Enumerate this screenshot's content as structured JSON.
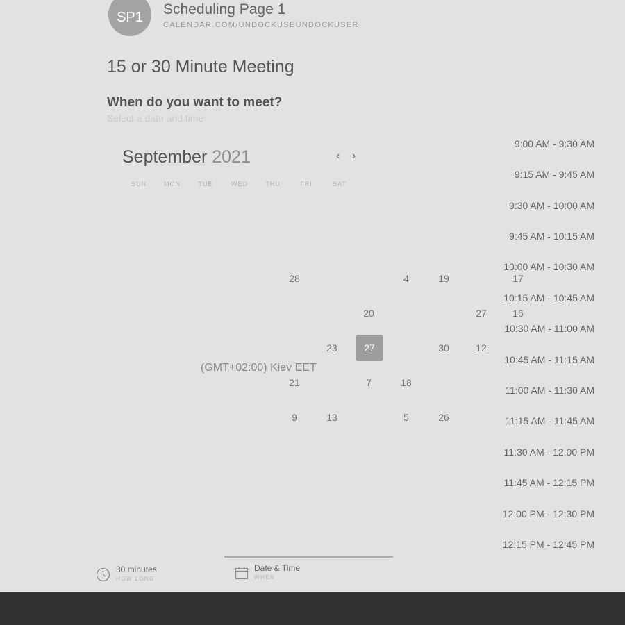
{
  "header": {
    "avatar_initials": "SP1",
    "page_name": "Scheduling Page 1",
    "page_url": "CALENDAR.COM/UNDOCKUSEUNDOCKUSER"
  },
  "meeting": {
    "title": "15 or 30 Minute Meeting",
    "question": "When do you want to meet?",
    "subtext": "Select a date and time"
  },
  "calendar": {
    "month": "September",
    "year": "2021",
    "prev_icon": "chevron-left-icon",
    "next_icon": "chevron-right-icon",
    "prev_glyph": "‹",
    "next_glyph": "›",
    "weekdays": [
      "SUN",
      "MON",
      "TUE",
      "WED",
      "THU",
      "FRI",
      "SAT"
    ],
    "visible_days": [
      "28",
      "4",
      "19",
      "17",
      "20",
      "27",
      "16",
      "23",
      "27",
      "30",
      "12",
      "21",
      "7",
      "18",
      "9",
      "13",
      "5",
      "26"
    ],
    "selected_day": "27",
    "timezone": "(GMT+02:00) Kiev EET"
  },
  "time_slots": [
    "9:00 AM - 9:30 AM",
    "9:15 AM - 9:45 AM",
    "9:30 AM - 10:00 AM",
    "9:45 AM - 10:15 AM",
    "10:00 AM - 10:30 AM",
    "10:15 AM - 10:45 AM",
    "10:30 AM - 11:00 AM",
    "10:45 AM - 11:15 AM",
    "11:00 AM - 11:30 AM",
    "11:15 AM - 11:45 AM",
    "11:30 AM - 12:00 PM",
    "11:45 AM - 12:15 PM",
    "12:00 PM - 12:30 PM",
    "12:15 PM - 12:45 PM"
  ],
  "footer": {
    "duration": {
      "label": "30 minutes",
      "sublabel": "HOW LONG",
      "icon": "clock-icon"
    },
    "datetime": {
      "label": "Date & Time",
      "sublabel": "WHEN",
      "icon": "calendar-icon"
    }
  }
}
